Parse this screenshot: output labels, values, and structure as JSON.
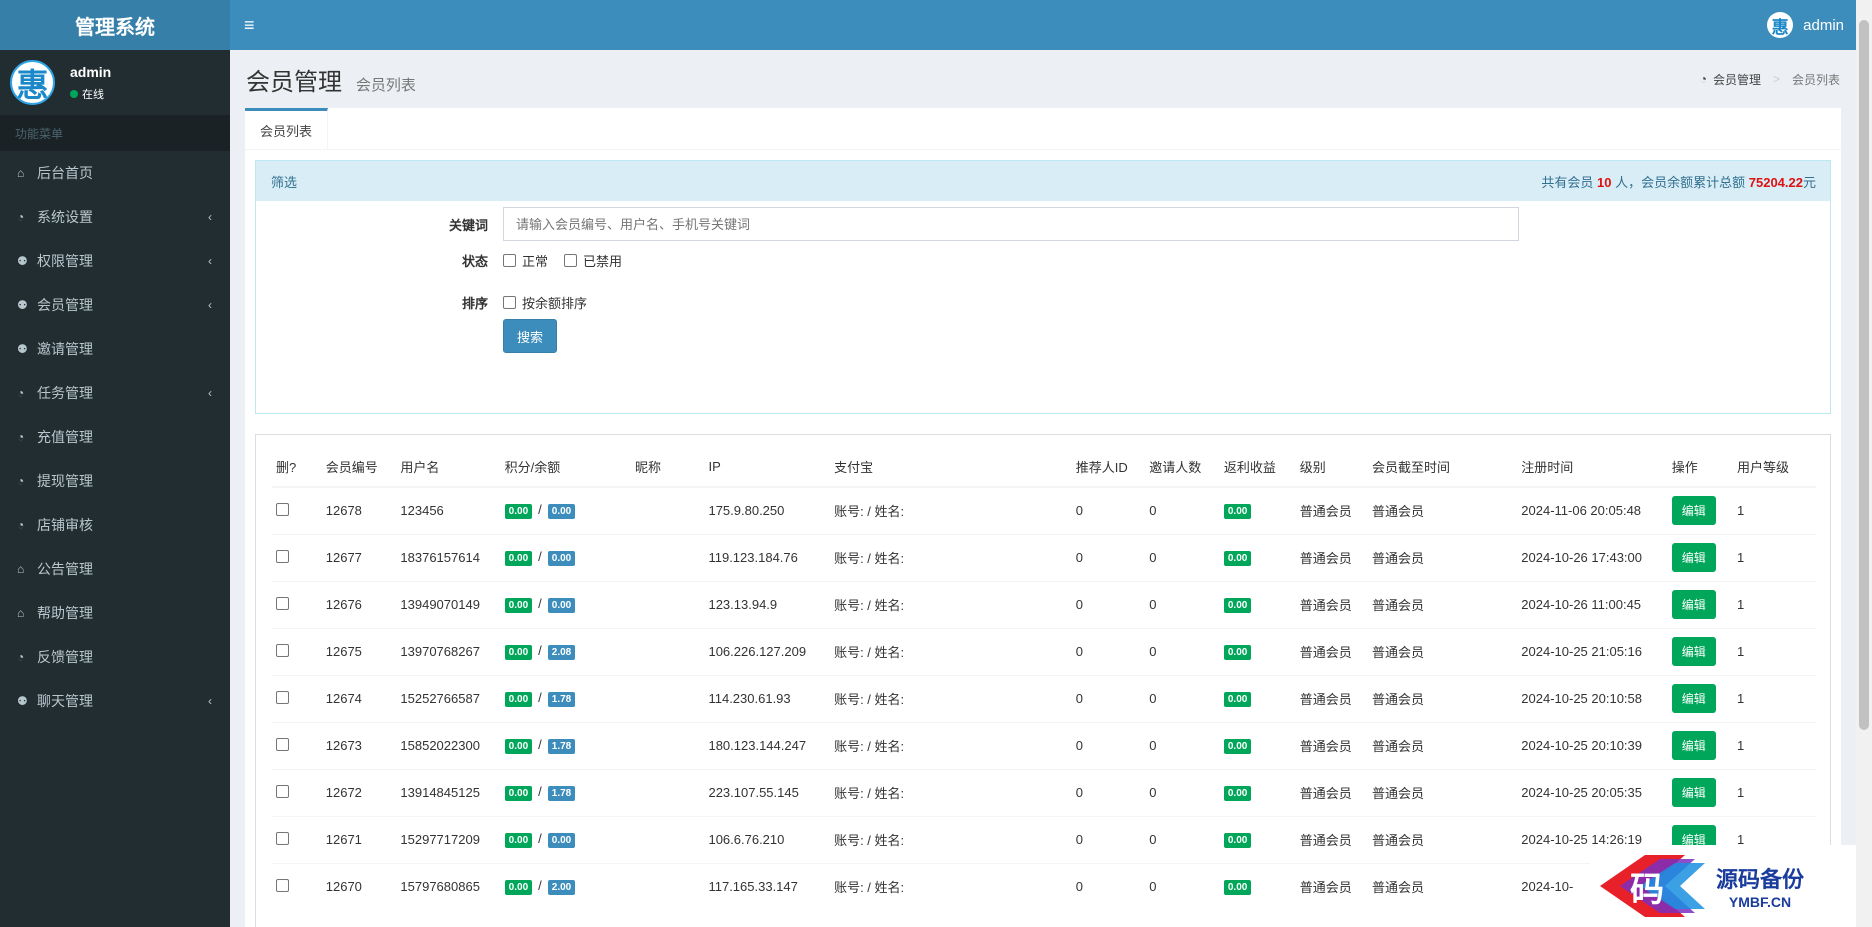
{
  "app": {
    "title": "管理系统"
  },
  "header": {
    "username": "admin",
    "avatar_char": "惠"
  },
  "sidebar": {
    "user": {
      "name": "admin",
      "status": "在线",
      "avatar_char": "惠"
    },
    "menu_header": "功能菜单",
    "items": [
      {
        "label": "后台首页",
        "icon": "home-icon",
        "glyph": "⌂",
        "has_children": false
      },
      {
        "label": "系统设置",
        "icon": "dashboard-icon",
        "glyph": "◔",
        "has_children": true
      },
      {
        "label": "权限管理",
        "icon": "users-icon",
        "glyph": "⚉",
        "has_children": true
      },
      {
        "label": "会员管理",
        "icon": "users-icon",
        "glyph": "⚉",
        "has_children": true
      },
      {
        "label": "邀请管理",
        "icon": "users-icon",
        "glyph": "⚉",
        "has_children": false
      },
      {
        "label": "任务管理",
        "icon": "dashboard-icon",
        "glyph": "◔",
        "has_children": true
      },
      {
        "label": "充值管理",
        "icon": "dashboard-icon",
        "glyph": "◔",
        "has_children": false
      },
      {
        "label": "提现管理",
        "icon": "dashboard-icon",
        "glyph": "◔",
        "has_children": false
      },
      {
        "label": "店铺审核",
        "icon": "dashboard-icon",
        "glyph": "◔",
        "has_children": false
      },
      {
        "label": "公告管理",
        "icon": "home-icon",
        "glyph": "⌂",
        "has_children": false
      },
      {
        "label": "帮助管理",
        "icon": "home-icon",
        "glyph": "⌂",
        "has_children": false
      },
      {
        "label": "反馈管理",
        "icon": "dashboard-icon",
        "glyph": "◔",
        "has_children": false
      },
      {
        "label": "聊天管理",
        "icon": "users-icon",
        "glyph": "⚉",
        "has_children": true
      }
    ]
  },
  "page": {
    "title": "会员管理",
    "subtitle": "会员列表",
    "breadcrumb": {
      "home": "会员管理",
      "current": "会员列表"
    },
    "tab": "会员列表"
  },
  "filter": {
    "header": "筛选",
    "stat_prefix": "共有会员",
    "member_count": "10",
    "stat_mid": "人，会员余额累计总额",
    "total_balance": "75204.22",
    "stat_suffix": "元",
    "keyword_label": "关键词",
    "keyword_placeholder": "请输入会员编号、用户名、手机号关键词",
    "status_label": "状态",
    "status_normal": "正常",
    "status_disabled": "已禁用",
    "sort_label": "排序",
    "sort_balance": "按余额排序",
    "search_button": "搜索"
  },
  "table": {
    "headers": [
      "删?",
      "会员编号",
      "用户名",
      "积分/余额",
      "昵称",
      "IP",
      "支付宝",
      "推荐人ID",
      "邀请人数",
      "返利收益",
      "级别",
      "会员截至时间",
      "注册时间",
      "操作",
      "用户等级"
    ],
    "edit_label": "编辑",
    "rows": [
      {
        "id": "12678",
        "username": "123456",
        "points": "0.00",
        "balance": "0.00",
        "nickname": "",
        "ip": "175.9.80.250",
        "alipay": "账号: / 姓名:",
        "referrer": "0",
        "invites": "0",
        "rebate": "0.00",
        "level": "普通会员",
        "expire": "普通会员",
        "reg_time": "2024-11-06 20:05:48",
        "grade": "1"
      },
      {
        "id": "12677",
        "username": "18376157614",
        "points": "0.00",
        "balance": "0.00",
        "nickname": "",
        "ip": "119.123.184.76",
        "alipay": "账号: / 姓名:",
        "referrer": "0",
        "invites": "0",
        "rebate": "0.00",
        "level": "普通会员",
        "expire": "普通会员",
        "reg_time": "2024-10-26 17:43:00",
        "grade": "1"
      },
      {
        "id": "12676",
        "username": "13949070149",
        "points": "0.00",
        "balance": "0.00",
        "nickname": "",
        "ip": "123.13.94.9",
        "alipay": "账号: / 姓名:",
        "referrer": "0",
        "invites": "0",
        "rebate": "0.00",
        "level": "普通会员",
        "expire": "普通会员",
        "reg_time": "2024-10-26 11:00:45",
        "grade": "1"
      },
      {
        "id": "12675",
        "username": "13970768267",
        "points": "0.00",
        "balance": "2.08",
        "nickname": "",
        "ip": "106.226.127.209",
        "alipay": "账号: / 姓名:",
        "referrer": "0",
        "invites": "0",
        "rebate": "0.00",
        "level": "普通会员",
        "expire": "普通会员",
        "reg_time": "2024-10-25 21:05:16",
        "grade": "1"
      },
      {
        "id": "12674",
        "username": "15252766587",
        "points": "0.00",
        "balance": "1.78",
        "nickname": "",
        "ip": "114.230.61.93",
        "alipay": "账号: / 姓名:",
        "referrer": "0",
        "invites": "0",
        "rebate": "0.00",
        "level": "普通会员",
        "expire": "普通会员",
        "reg_time": "2024-10-25 20:10:58",
        "grade": "1"
      },
      {
        "id": "12673",
        "username": "15852022300",
        "points": "0.00",
        "balance": "1.78",
        "nickname": "",
        "ip": "180.123.144.247",
        "alipay": "账号: / 姓名:",
        "referrer": "0",
        "invites": "0",
        "rebate": "0.00",
        "level": "普通会员",
        "expire": "普通会员",
        "reg_time": "2024-10-25 20:10:39",
        "grade": "1"
      },
      {
        "id": "12672",
        "username": "13914845125",
        "points": "0.00",
        "balance": "1.78",
        "nickname": "",
        "ip": "223.107.55.145",
        "alipay": "账号: / 姓名:",
        "referrer": "0",
        "invites": "0",
        "rebate": "0.00",
        "level": "普通会员",
        "expire": "普通会员",
        "reg_time": "2024-10-25 20:05:35",
        "grade": "1"
      },
      {
        "id": "12671",
        "username": "15297717209",
        "points": "0.00",
        "balance": "0.00",
        "nickname": "",
        "ip": "106.6.76.210",
        "alipay": "账号: / 姓名:",
        "referrer": "0",
        "invites": "0",
        "rebate": "0.00",
        "level": "普通会员",
        "expire": "普通会员",
        "reg_time": "2024-10-25 14:26:19",
        "grade": "1"
      },
      {
        "id": "12670",
        "username": "15797680865",
        "points": "0.00",
        "balance": "2.00",
        "nickname": "",
        "ip": "117.165.33.147",
        "alipay": "账号: / 姓名:",
        "referrer": "0",
        "invites": "0",
        "rebate": "0.00",
        "level": "普通会员",
        "expire": "普通会员",
        "reg_time": "2024-10-",
        "grade": ""
      }
    ]
  },
  "watermark": {
    "main": "源码备份",
    "sub": "YMBF.CN",
    "logo_char": "码"
  },
  "colors": {
    "header": "#3c8dbc",
    "logo_bg": "#367fa9",
    "sidebar": "#222d32",
    "success": "#00a65a",
    "danger": "#dd1111"
  }
}
